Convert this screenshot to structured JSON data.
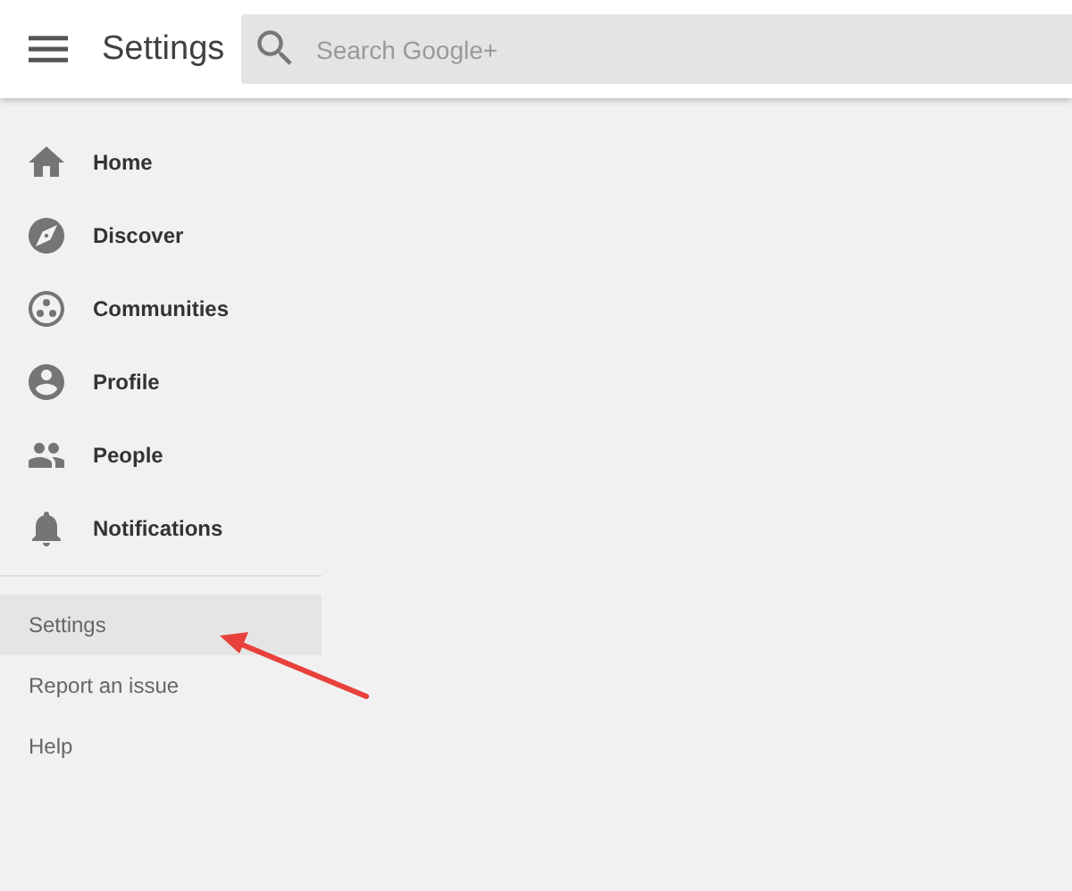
{
  "header": {
    "title": "Settings",
    "search": {
      "placeholder": "Search Google+"
    }
  },
  "nav": [
    {
      "label": "Home",
      "kind": "home"
    },
    {
      "label": "Discover",
      "kind": "discover"
    },
    {
      "label": "Communities",
      "kind": "communities"
    },
    {
      "label": "Profile",
      "kind": "profile"
    },
    {
      "label": "People",
      "kind": "people"
    },
    {
      "label": "Notifications",
      "kind": "notifications"
    }
  ],
  "secondary": [
    {
      "label": "Settings",
      "selected": true
    },
    {
      "label": "Report an issue",
      "selected": false
    },
    {
      "label": "Help",
      "selected": false
    }
  ],
  "annotation": {
    "kind": "arrow"
  }
}
